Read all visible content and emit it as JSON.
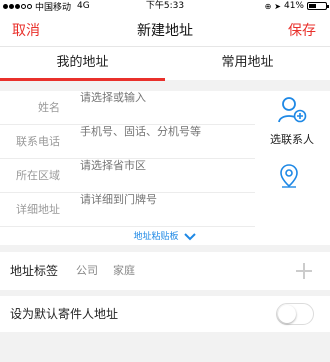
{
  "status_bar": {
    "carrier": "中国移动",
    "network": "4G",
    "time": "下午5:33",
    "battery_text": "41%",
    "battery_level": 0.41
  },
  "nav": {
    "cancel_label": "取消",
    "title": "新建地址",
    "save_label": "保存"
  },
  "tabs": [
    {
      "label": "我的地址",
      "selected": true
    },
    {
      "label": "常用地址",
      "selected": false
    }
  ],
  "form": {
    "fields": [
      {
        "label": "姓名",
        "placeholder": "请选择或输入",
        "value": ""
      },
      {
        "label": "联系电话",
        "placeholder": "手机号、固话、分机号等",
        "value": ""
      },
      {
        "label": "所在区域",
        "placeholder": "请选择省市区",
        "value": ""
      },
      {
        "label": "详细地址",
        "placeholder": "请详细到门牌号",
        "value": ""
      }
    ],
    "contact_label": "选联系人",
    "paste_label": "地址粘贴板"
  },
  "address_tags": {
    "title": "地址标签",
    "tags": [
      "公司",
      "家庭"
    ]
  },
  "default_sender": {
    "label": "设为默认寄件人地址",
    "enabled": false
  },
  "colors": {
    "accent": "#e9302b",
    "link": "#1e88e5",
    "icon_blue": "#1e88e5"
  },
  "icons": {
    "contact": "add-contact-icon",
    "location": "location-pin-icon",
    "paste_chevron": "chevron-down-icon",
    "add_tag": "plus-icon"
  }
}
